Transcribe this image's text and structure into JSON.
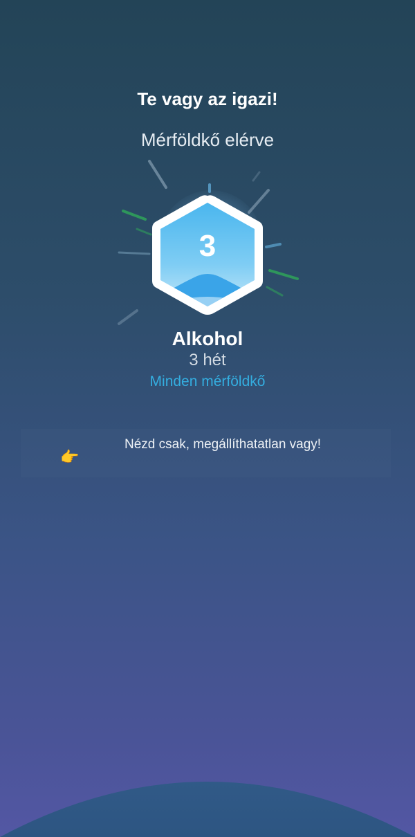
{
  "header": {
    "title": "Te vagy az igazi!",
    "subtitle": "Mérföldkő elérve"
  },
  "milestone": {
    "number": "3",
    "category": "Alkohol",
    "duration": "3 hét",
    "all_milestones_link": "Minden mérföldkő"
  },
  "message": {
    "icon": "pointing-hand-icon",
    "emoji": "👉",
    "text": "Nézd csak, megállíthatatlan vagy!"
  },
  "colors": {
    "link": "#34aee0",
    "badge_blue": "#5cc3f2",
    "ray_green": "#2f9e5a"
  }
}
